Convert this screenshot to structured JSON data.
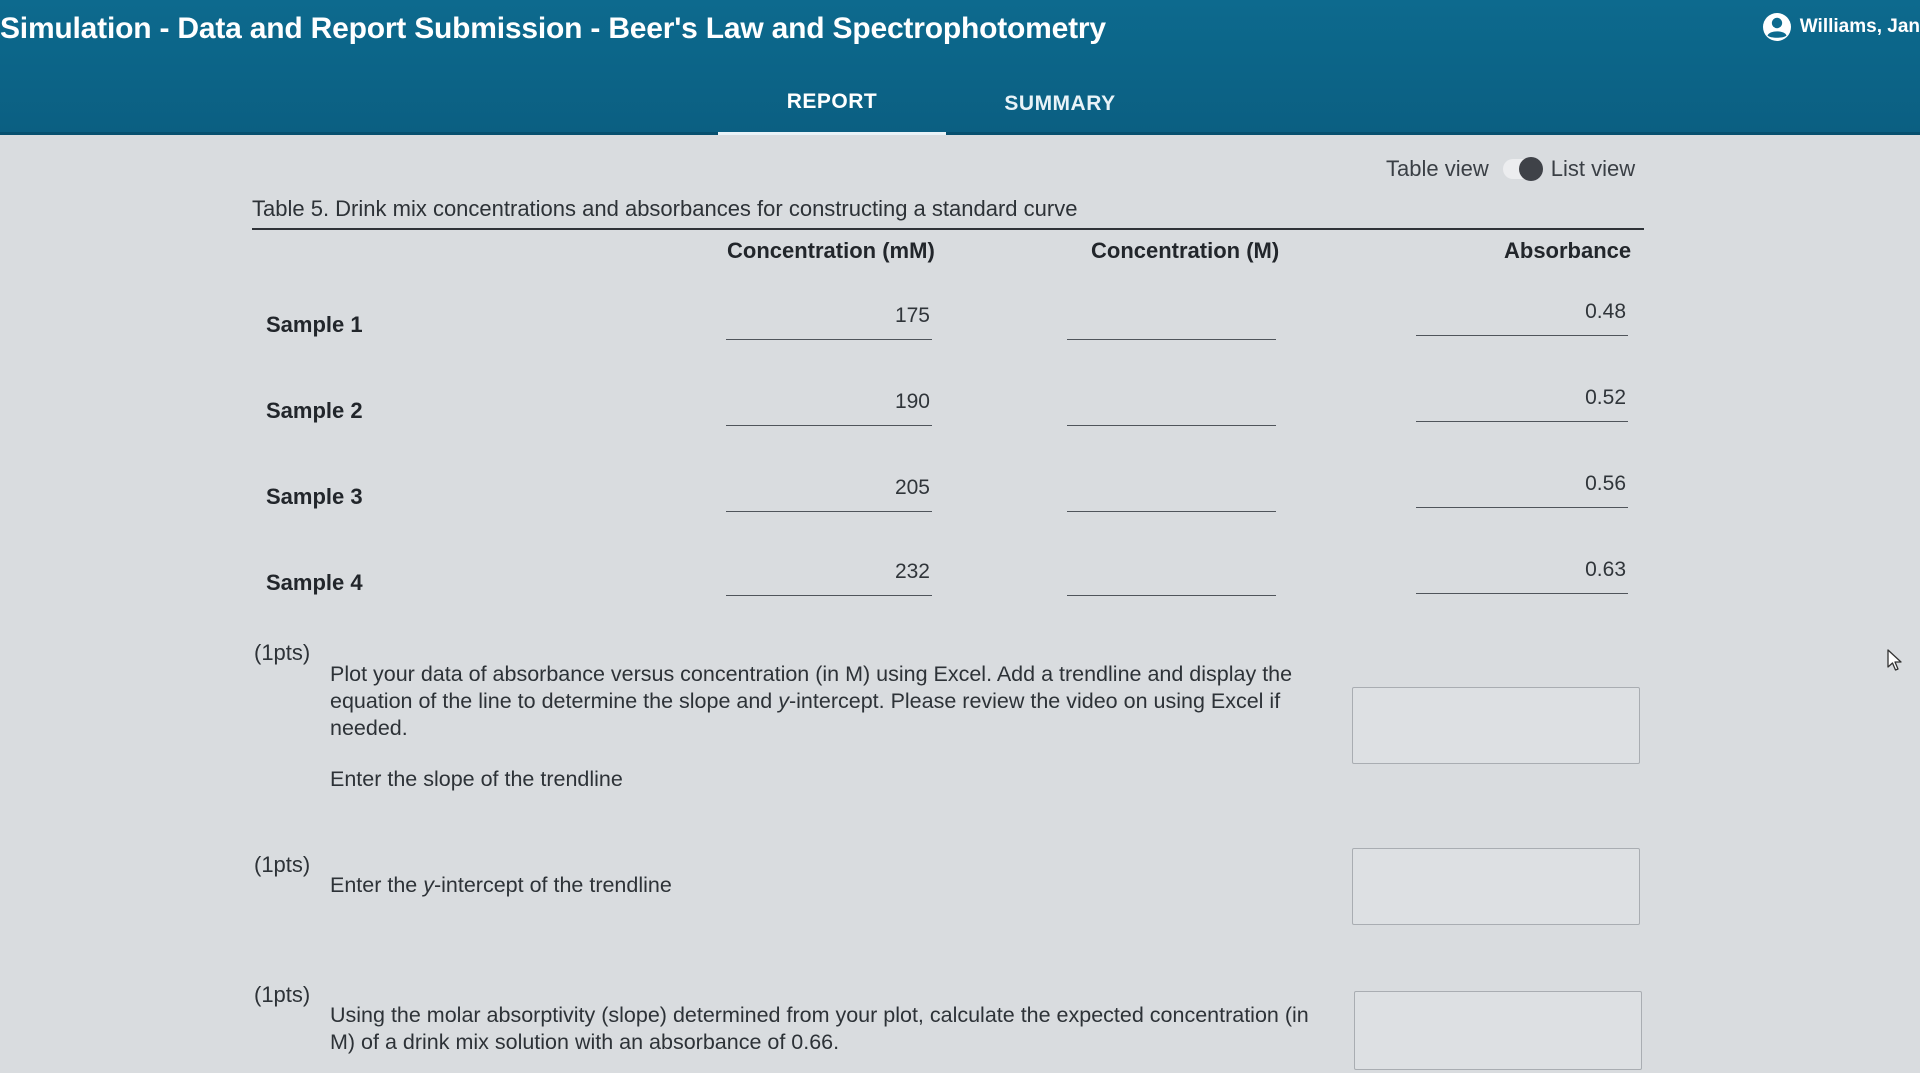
{
  "header": {
    "title": "Simulation - Data and Report Submission - Beer's Law and Spectrophotometry",
    "user_name": "Williams, Jan",
    "tabs": [
      "REPORT",
      "SUMMARY"
    ],
    "active_tab": "REPORT",
    "bg_color": "#0b5f82"
  },
  "view_toggle": {
    "left_label": "Table view",
    "right_label": "List view",
    "state": "List view"
  },
  "table": {
    "caption": "Table 5. Drink mix concentrations and absorbances for constructing a standard curve",
    "columns": [
      "Concentration (mM)",
      "Concentration (M)",
      "Absorbance"
    ],
    "rows": [
      {
        "label": "Sample 1",
        "conc_mM": "175",
        "conc_M": "",
        "absorbance": "0.48"
      },
      {
        "label": "Sample 2",
        "conc_mM": "190",
        "conc_M": "",
        "absorbance": "0.52"
      },
      {
        "label": "Sample 3",
        "conc_mM": "205",
        "conc_M": "",
        "absorbance": "0.56"
      },
      {
        "label": "Sample 4",
        "conc_mM": "232",
        "conc_M": "",
        "absorbance": "0.63"
      }
    ]
  },
  "questions": [
    {
      "points": "(1pts)",
      "text_before_y": "Plot your data of absorbance versus concentration (in M) using Excel. Add a trendline and display the equation of the line to determine the slope and ",
      "y_char": "y",
      "text_after_y": "-intercept. Please review the video on using Excel if needed.",
      "prompt": "Enter the slope of the trendline",
      "answer": ""
    },
    {
      "points": "(1pts)",
      "prompt_before_y": "Enter the ",
      "y_char": "y",
      "prompt_after_y": "-intercept of the trendline",
      "answer": ""
    },
    {
      "points": "(1pts)",
      "text": "Using the molar absorptivity (slope) determined from your plot, calculate the expected concentration (in M) of a drink mix solution with an absorbance of 0.66.",
      "answer": ""
    }
  ],
  "icons": {
    "user": "user-avatar-icon",
    "cursor": "mouse-pointer-icon"
  }
}
